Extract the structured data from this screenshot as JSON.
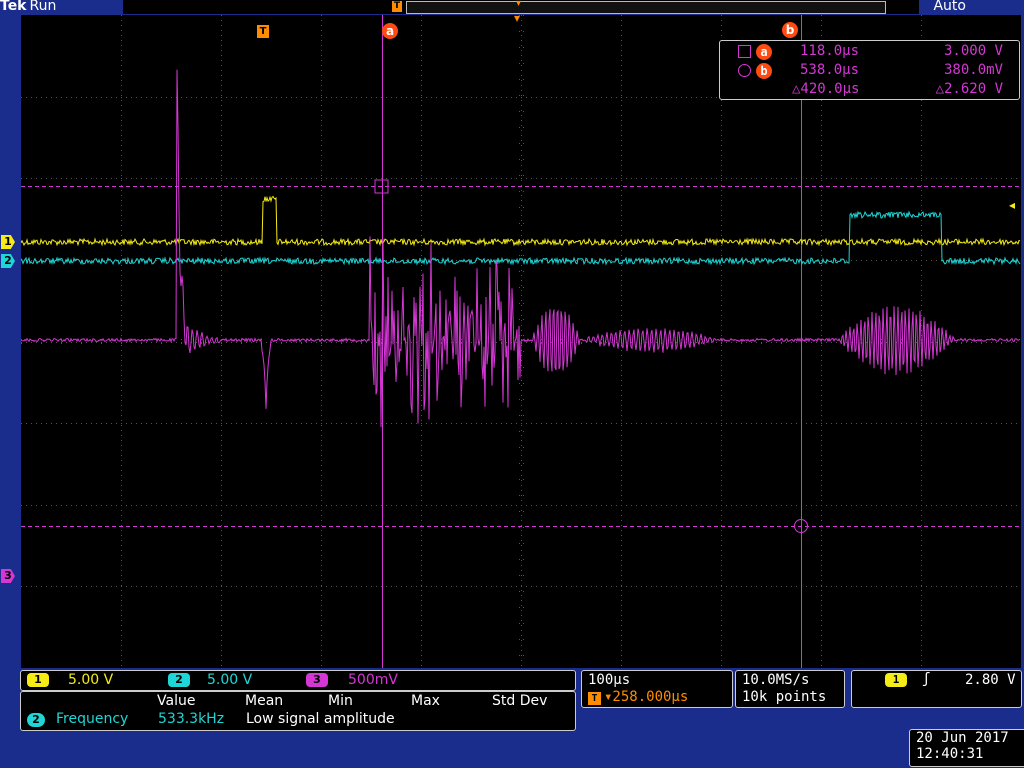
{
  "header": {
    "brand": "Tek",
    "state": "Run",
    "acquisition_mode": "Auto"
  },
  "markers": {
    "trigger": "T",
    "cursor_a": "a",
    "cursor_b": "b"
  },
  "cursor_readout": {
    "a": {
      "time": "118.0µs",
      "value": "3.000 V"
    },
    "b": {
      "time": "538.0µs",
      "value": "380.0mV"
    },
    "delta": {
      "time": "△420.0µs",
      "value": "△2.620 V"
    }
  },
  "channels": [
    {
      "number": "1",
      "scale": "5.00 V",
      "color": "#f5ec16"
    },
    {
      "number": "2",
      "scale": "5.00 V",
      "color": "#1fd6d6"
    },
    {
      "number": "3",
      "scale": "500mV",
      "color": "#d437d4"
    }
  ],
  "measurement": {
    "headers": [
      "Value",
      "Mean",
      "Min",
      "Max",
      "Std Dev"
    ],
    "channel": "2",
    "name": "Frequency",
    "value": "533.3kHz",
    "note": "Low signal amplitude"
  },
  "timebase": {
    "scale": "100µs",
    "delay": "▾258.000µs"
  },
  "sampling": {
    "rate": "10.0MS/s",
    "record": "10k points"
  },
  "trigger": {
    "channel": "1",
    "slope_symbol": "ʃ",
    "level": "2.80 V"
  },
  "datetime": {
    "date": "20 Jun 2017",
    "time": "12:40:31"
  }
}
